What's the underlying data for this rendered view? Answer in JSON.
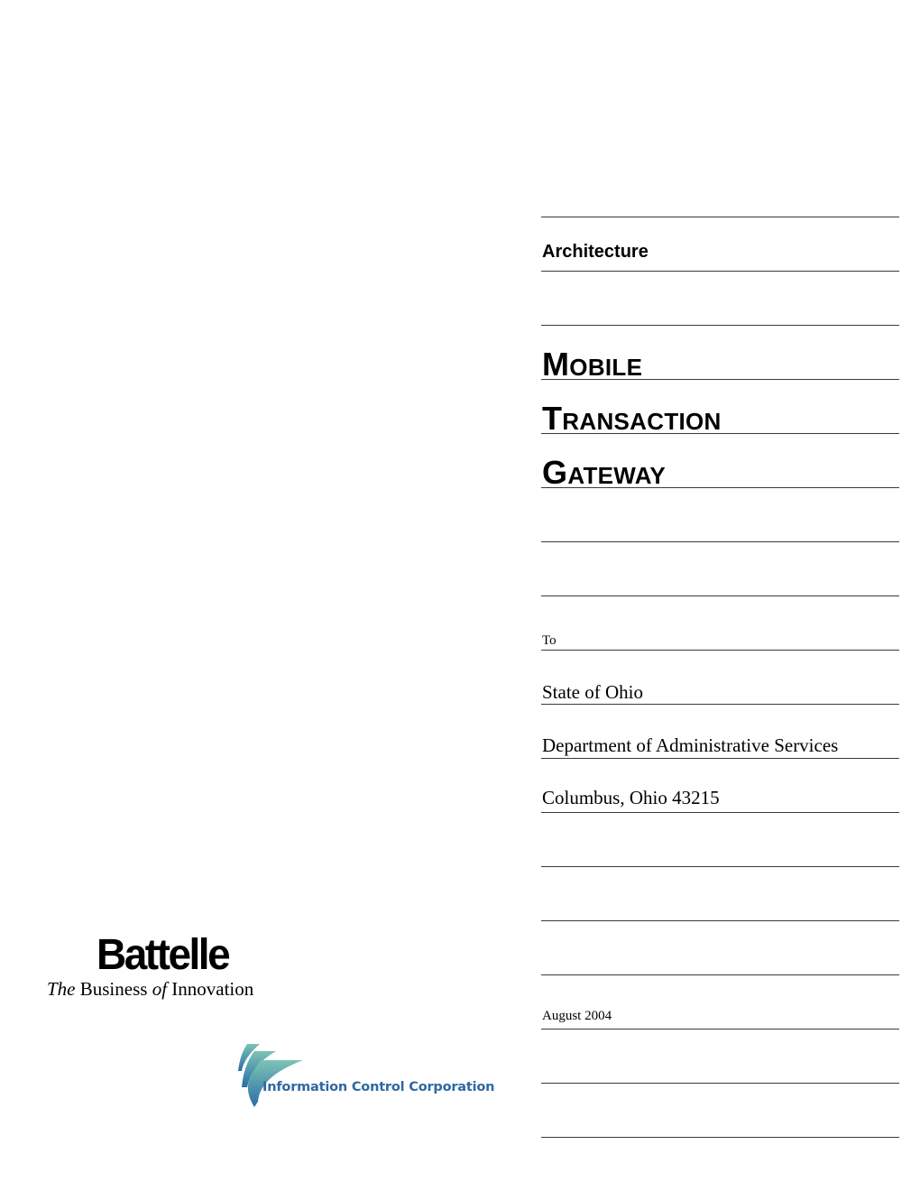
{
  "document": {
    "category": "Architecture",
    "title_lines": [
      {
        "first": "M",
        "rest": "OBILE"
      },
      {
        "first": "T",
        "rest": "RANSACTION"
      },
      {
        "first": "G",
        "rest": "ATEWAY"
      }
    ],
    "to_label": "To",
    "recipient": {
      "line1": "State of Ohio",
      "line2": "Department of Administrative Services",
      "line3": "Columbus, Ohio 43215"
    },
    "date": "August 2004"
  },
  "logos": {
    "battelle": {
      "name": "Battelle",
      "tagline_the": "The",
      "tagline_business": " Business ",
      "tagline_of": "of",
      "tagline_innovation": " Innovation"
    },
    "icc": {
      "name": "Information Control Corporation",
      "colors": {
        "text": "#2f68a3",
        "swoosh_light": "#7cc4b4",
        "swoosh_dark": "#2b6ea8"
      }
    }
  }
}
